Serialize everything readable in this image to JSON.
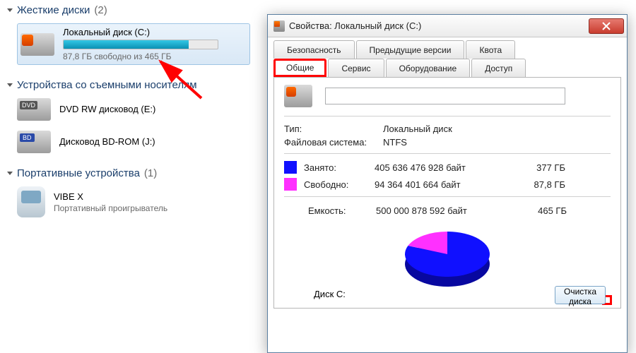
{
  "explorer": {
    "groups": {
      "hdd": {
        "title": "Жесткие диски",
        "count": "(2)"
      },
      "removable": {
        "title": "Устройства со съемными носителям",
        "count": ""
      },
      "portable": {
        "title": "Портативные устройства",
        "count": "(1)"
      }
    },
    "drive_c": {
      "title": "Локальный диск (C:)",
      "sub": "87,8 ГБ свободно из 465 ГБ"
    },
    "dvd": {
      "title": "DVD RW дисковод (E:)"
    },
    "bd": {
      "title": "Дисковод BD-ROM (J:)"
    },
    "vibe": {
      "title": "VIBE X",
      "sub": "Портативный проигрыватель"
    }
  },
  "dialog": {
    "title": "Свойства: Локальный диск (C:)",
    "tabs_top": {
      "security": "Безопасность",
      "prev": "Предыдущие версии",
      "quota": "Квота"
    },
    "tabs_bottom": {
      "general": "Общие",
      "service": "Сервис",
      "hardware": "Оборудование",
      "access": "Доступ"
    },
    "name_value": "",
    "type_label": "Тип:",
    "type_value": "Локальный диск",
    "fs_label": "Файловая система:",
    "fs_value": "NTFS",
    "used_label": "Занято:",
    "used_bytes": "405 636 476 928 байт",
    "used_gb": "377 ГБ",
    "free_label": "Свободно:",
    "free_bytes": "94 364 401 664 байт",
    "free_gb": "87,8 ГБ",
    "cap_label": "Емкость:",
    "cap_bytes": "500 000 878 592 байт",
    "cap_gb": "465 ГБ",
    "disk_label": "Диск C:",
    "cleanup": "Очистка диска"
  },
  "chart_data": {
    "type": "pie",
    "title": "",
    "series": [
      {
        "name": "Занято",
        "value": 405636476928,
        "color": "#1010ff"
      },
      {
        "name": "Свободно",
        "value": 94364401664,
        "color": "#ff30ff"
      }
    ]
  },
  "colors": {
    "highlight": "#ff0000",
    "used": "#1010ff",
    "free": "#ff30ff"
  }
}
